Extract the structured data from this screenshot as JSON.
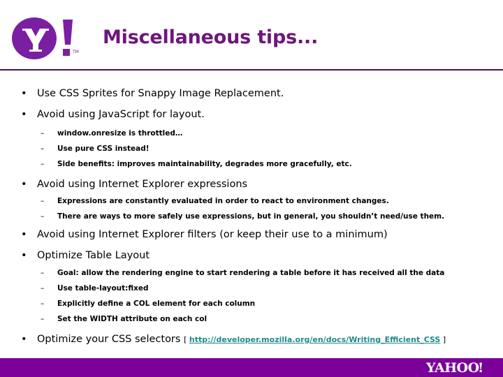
{
  "theme": {
    "brand_purple": "#7b0099",
    "title_purple": "#70157f",
    "rule_purple": "#4a1259",
    "link_teal": "#1f8a8a",
    "text_black": "#000000",
    "background": "#ffffff"
  },
  "header": {
    "title": "Miscellaneous tips...",
    "logo_alt": "Yahoo! logo",
    "logo_letter": "Y",
    "logo_tm": "TM"
  },
  "bullets": [
    {
      "level": 1,
      "marker": "•",
      "text": "Use CSS Sprites for Snappy Image Replacement."
    },
    {
      "level": 1,
      "marker": "•",
      "text": "Avoid using JavaScript for layout."
    },
    {
      "level": 2,
      "marker": "–",
      "text": "window.onresize is throttled…"
    },
    {
      "level": 2,
      "marker": "–",
      "text": "Use pure CSS instead!"
    },
    {
      "level": 2,
      "marker": "–",
      "text": "Side benefits: improves maintainability, degrades more gracefully, etc."
    },
    {
      "level": 1,
      "marker": "•",
      "text": "Avoid using Internet Explorer expressions"
    },
    {
      "level": 2,
      "marker": "–",
      "text": "Expressions are constantly evaluated in order to react to environment changes."
    },
    {
      "level": 2,
      "marker": "–",
      "text": "There are ways to more safely use expressions, but in general, you shouldn’t need/use them."
    },
    {
      "level": 1,
      "marker": "•",
      "text": "Avoid using Internet Explorer filters (or keep their use to a minimum)"
    },
    {
      "level": 1,
      "marker": "•",
      "text": "Optimize Table Layout"
    },
    {
      "level": 2,
      "marker": "–",
      "text": "Goal: allow the rendering engine to start rendering a table before it has received all the data"
    },
    {
      "level": 2,
      "marker": "–",
      "text": "Use table-layout:fixed"
    },
    {
      "level": 2,
      "marker": "–",
      "text": "Explicitly define a COL element for each column"
    },
    {
      "level": 2,
      "marker": "–",
      "text": "Set the WIDTH attribute on each col"
    }
  ],
  "last_bullet": {
    "marker": "•",
    "text": "Optimize your CSS selectors ",
    "bracket_open": "[ ",
    "link_text": "http://developer.mozilla.org/en/docs/Writing_Efficient_CSS",
    "bracket_close": " ]"
  },
  "footer": {
    "wordmark": "YAHOO!",
    "background": "#7b0099"
  }
}
